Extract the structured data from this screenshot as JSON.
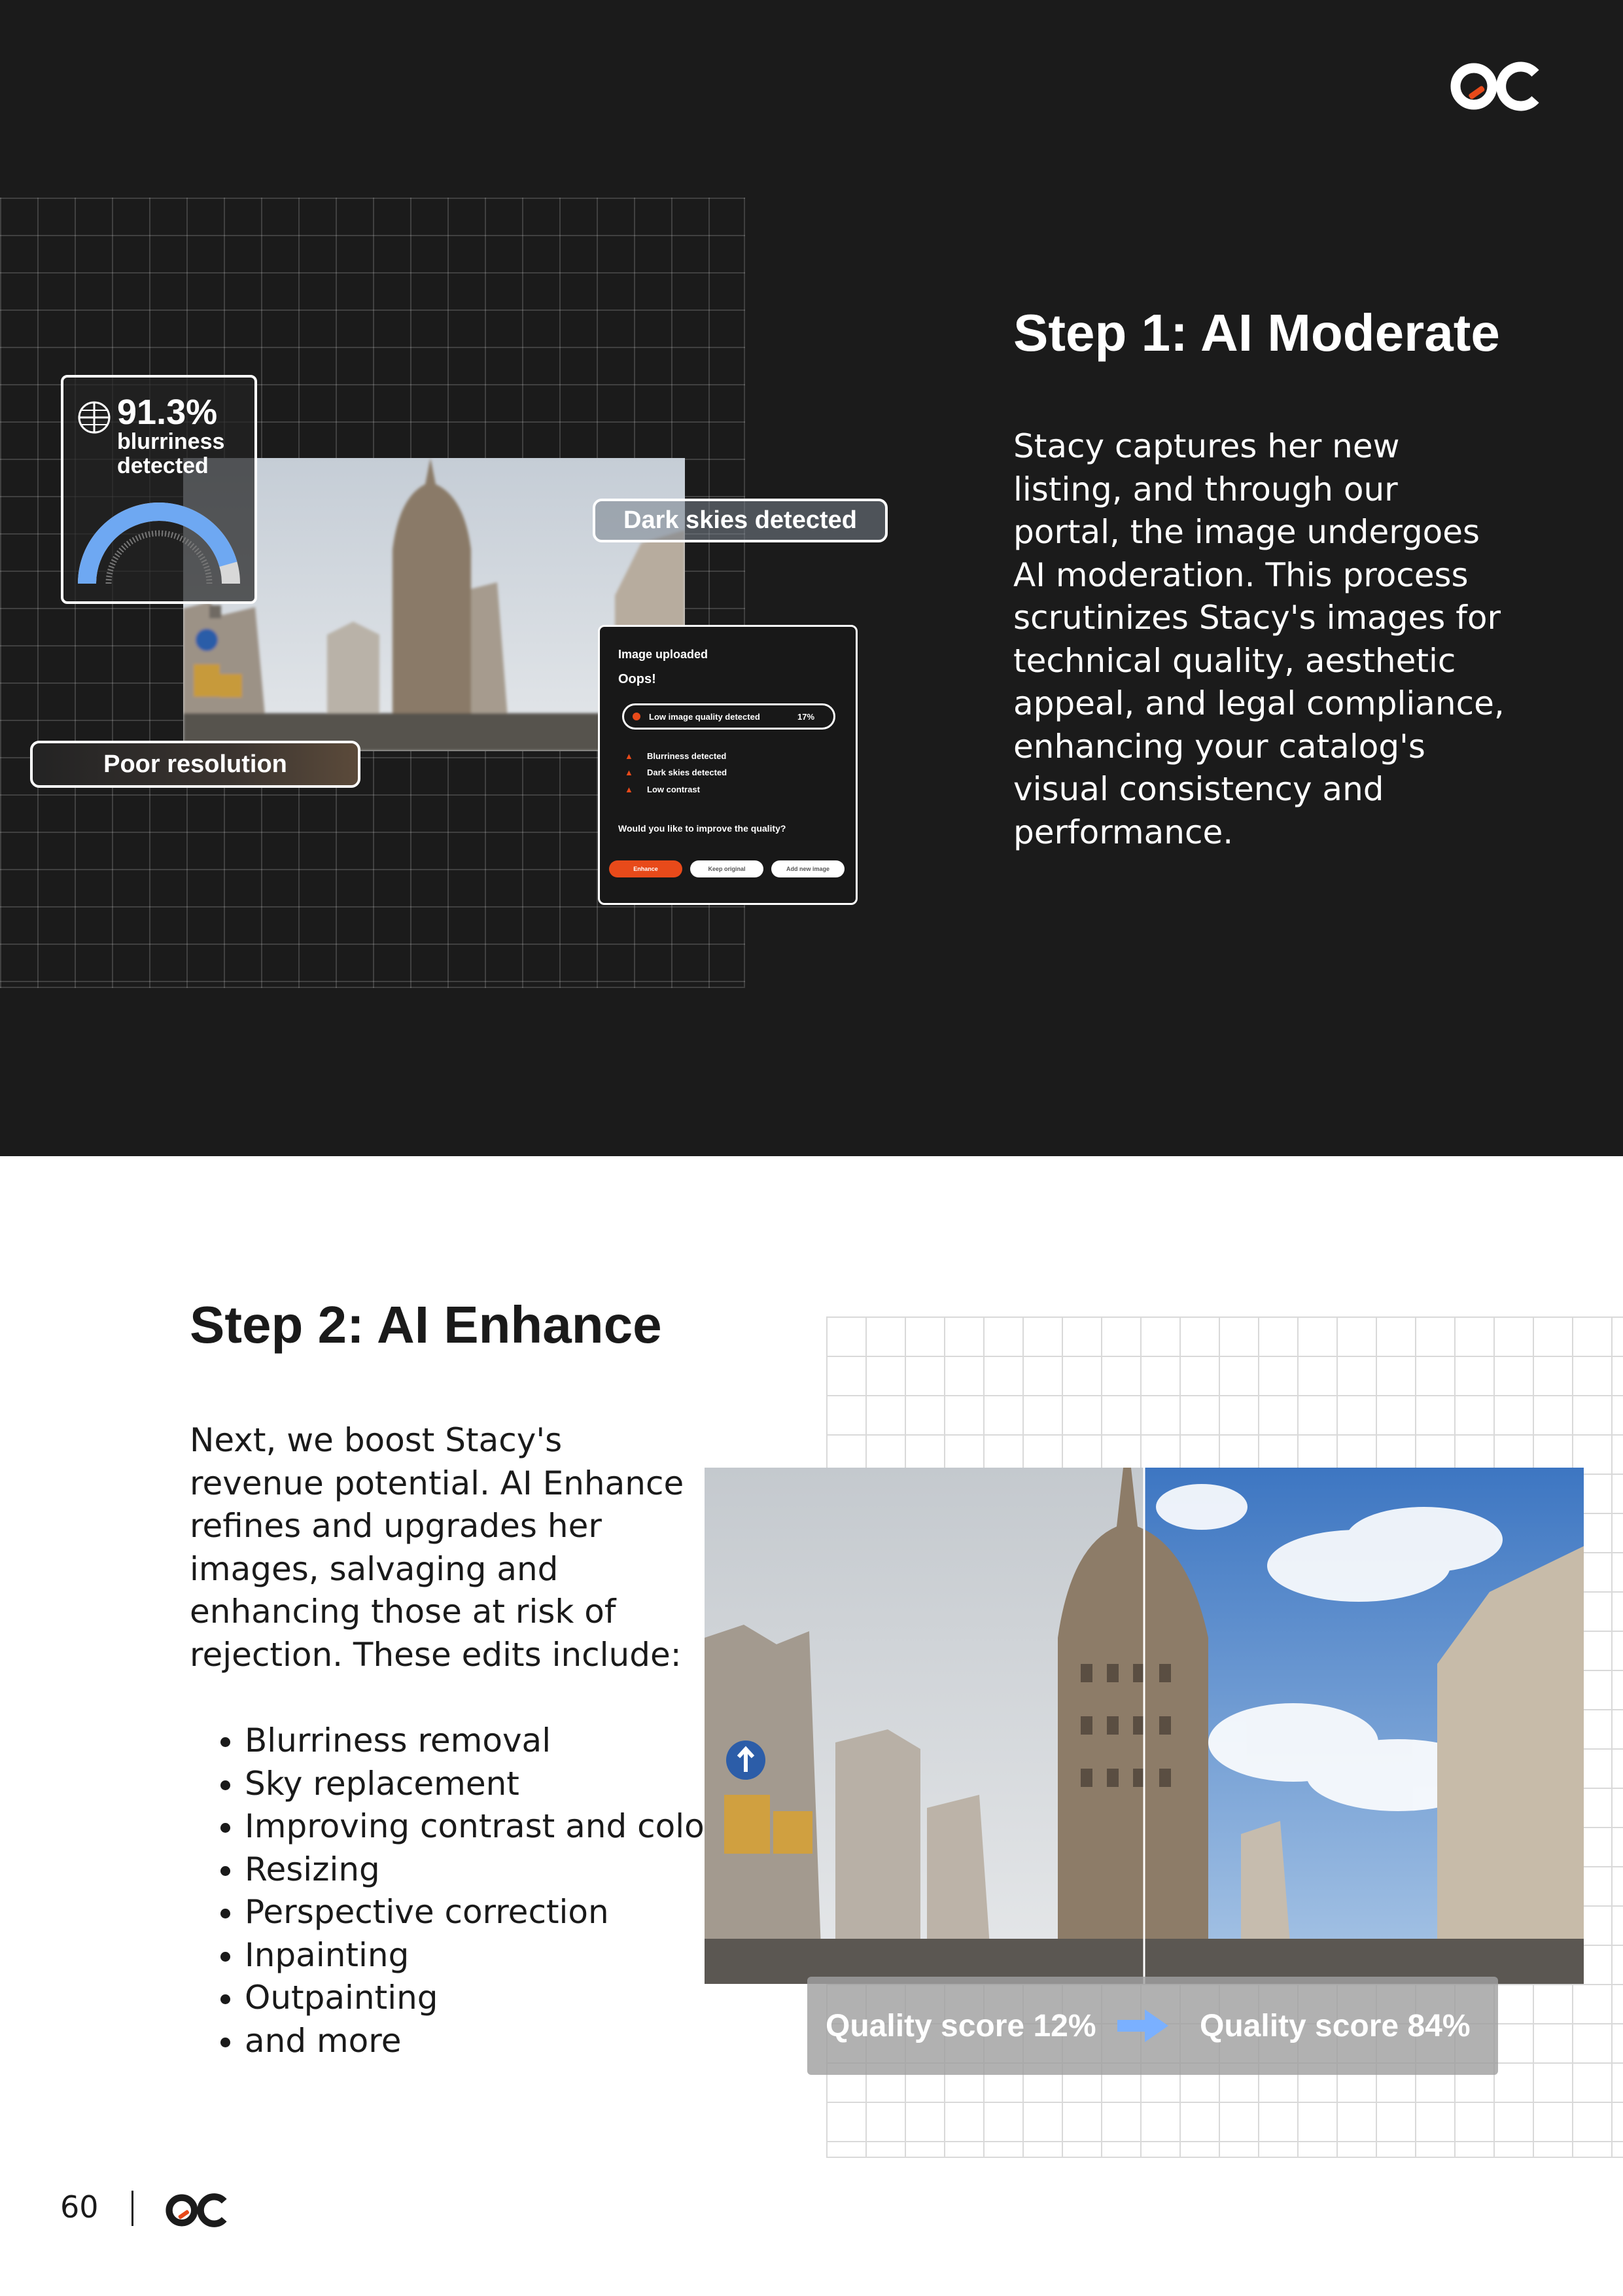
{
  "colors": {
    "dark_background": "#1b1b1b",
    "brand_accent": "#e84a1a",
    "score_arrow": "#7ab0ff",
    "gauge_blue": "#6ea8f2"
  },
  "step1": {
    "heading": "Step 1: AI Moderate",
    "body": "Stacy captures her new listing, and through our portal, the image undergoes AI moderation. This process scrutinizes Stacy's images for technical quality, aesthetic appeal, and legal compliance, enhancing your catalog's visual consistency and performance."
  },
  "moderation_ui": {
    "blur_value": "91.3%",
    "blur_label": "blurriness detected",
    "blur_gauge_level": 0.913,
    "dark_skies_label": "Dark skies detected",
    "poor_resolution_label": "Poor resolution",
    "dialog": {
      "title": "Image uploaded",
      "subtitle": "Oops!",
      "quality_alert": "Low image quality detected",
      "quality_percent": "17%",
      "issues": [
        "Blurriness detected",
        "Dark skies detected",
        "Low contrast"
      ],
      "question": "Would you like to improve the quality?",
      "buttons": [
        "Enhance",
        "Keep original",
        "Add new image"
      ]
    }
  },
  "step2": {
    "heading": "Step 2: AI Enhance",
    "body": "Next, we boost Stacy's revenue potential. AI Enhance refines and upgrades her images, salvaging and enhancing those at risk of rejection. These edits include:",
    "edits": [
      "Blurriness removal",
      "Sky replacement",
      "Improving contrast and color",
      "Resizing",
      "Perspective correction",
      "Inpainting",
      "Outpainting",
      "and more"
    ],
    "quality_before": "Quality score 12%",
    "quality_after": "Quality score 84%"
  },
  "footer": {
    "page_number": "60"
  }
}
